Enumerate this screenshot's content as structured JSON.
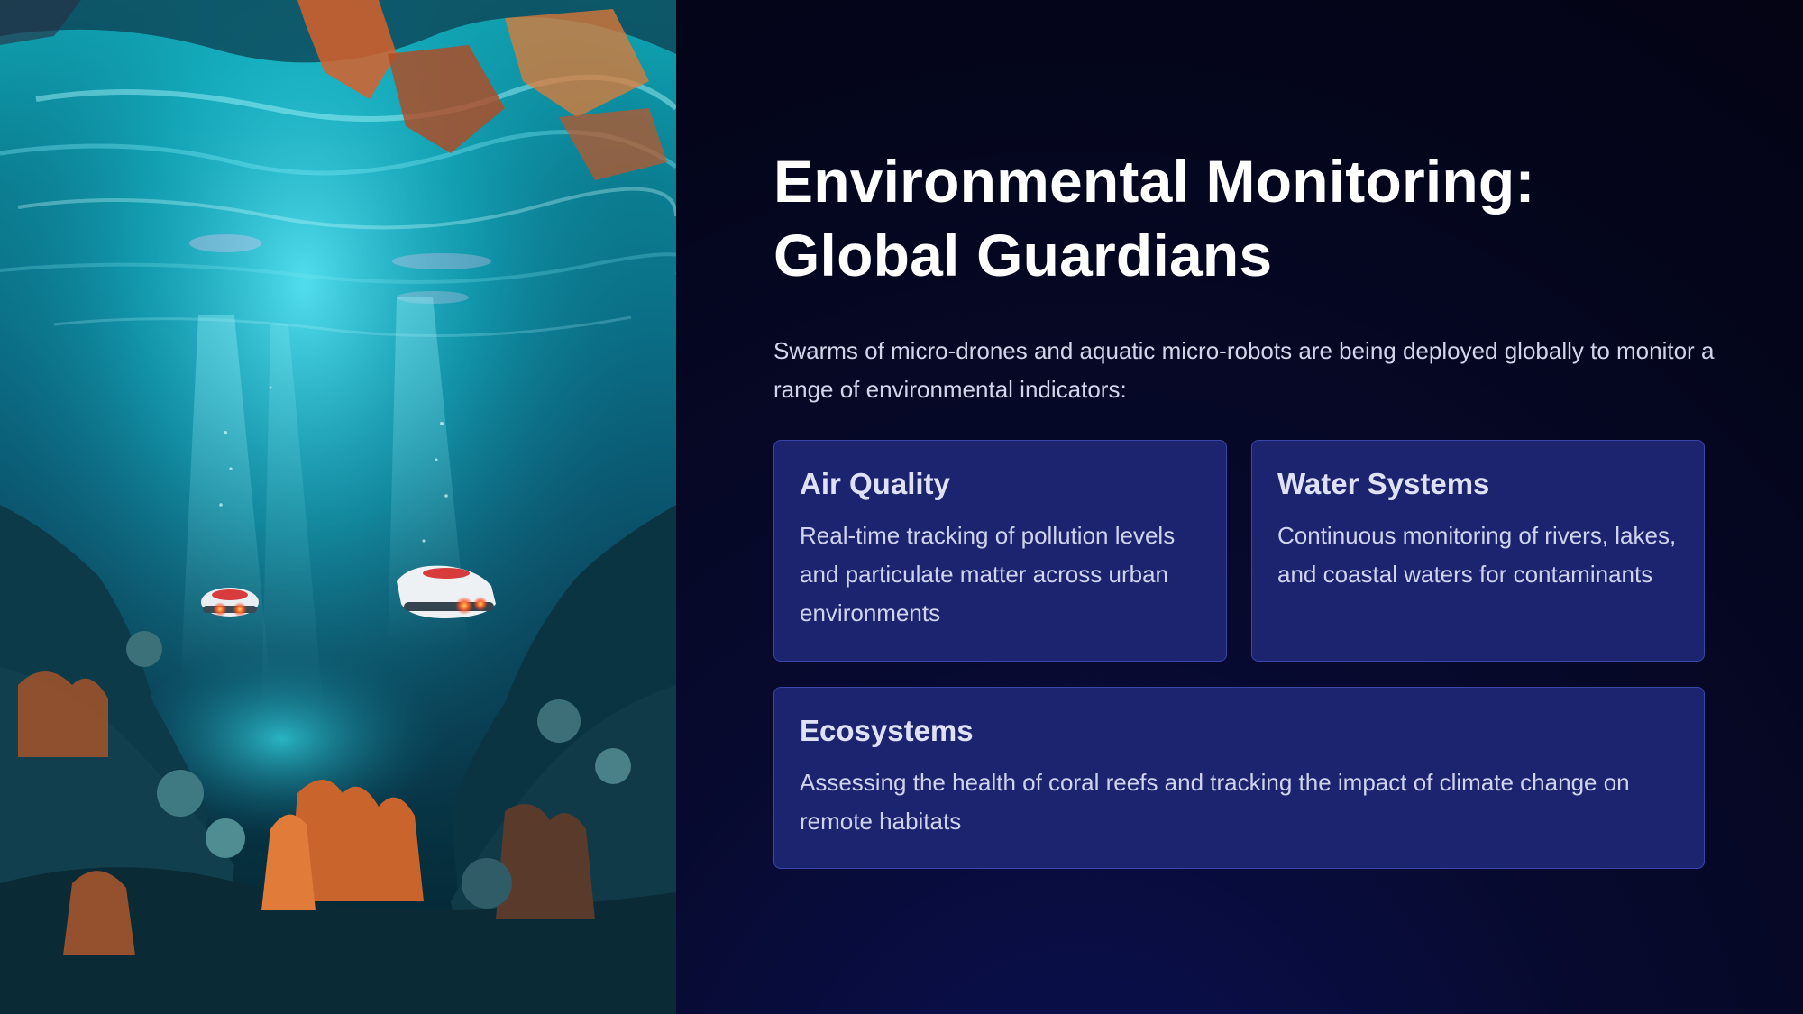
{
  "slide": {
    "title": "Environmental Monitoring: Global Guardians",
    "intro": "Swarms of micro-drones and aquatic micro-robots are being deployed globally to monitor a range of environmental indicators:",
    "image": {
      "subject": "underwater-reef-with-micro-robots-photo"
    },
    "cards": [
      {
        "heading": "Air Quality",
        "body": "Real-time tracking of pollution levels and particulate matter across urban environments"
      },
      {
        "heading": "Water Systems",
        "body": "Continuous monitoring of rivers, lakes, and coastal waters for contaminants"
      },
      {
        "heading": "Ecosystems",
        "body": "Assessing the health of coral reefs and tracking the impact of climate change on remote habitats"
      }
    ]
  },
  "colors": {
    "background": "#05061a",
    "card_fill": "#1c2470",
    "card_border": "#3a46a8",
    "title_text": "#ffffff",
    "body_text": "#cfd3ee"
  }
}
